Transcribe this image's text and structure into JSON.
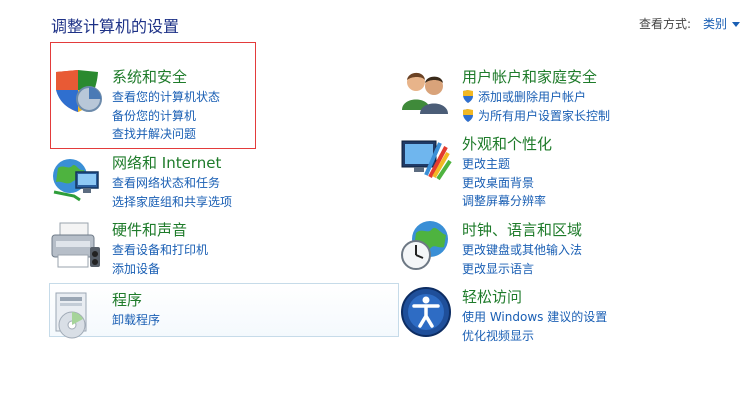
{
  "header": {
    "title": "调整计算机的设置",
    "view_label": "查看方式:",
    "view_value": "类别"
  },
  "left": [
    {
      "title": "系统和安全",
      "links": [
        "查看您的计算机状态",
        "备份您的计算机",
        "查找并解决问题"
      ]
    },
    {
      "title": "网络和 Internet",
      "links": [
        "查看网络状态和任务",
        "选择家庭组和共享选项"
      ]
    },
    {
      "title": "硬件和声音",
      "links": [
        "查看设备和打印机",
        "添加设备"
      ]
    },
    {
      "title": "程序",
      "links": [
        "卸载程序"
      ]
    }
  ],
  "right": [
    {
      "title": "用户帐户和家庭安全",
      "links": [
        "添加或删除用户帐户",
        "为所有用户设置家长控制"
      ]
    },
    {
      "title": "外观和个性化",
      "links": [
        "更改主题",
        "更改桌面背景",
        "调整屏幕分辨率"
      ]
    },
    {
      "title": "时钟、语言和区域",
      "links": [
        "更改键盘或其他输入法",
        "更改显示语言"
      ]
    },
    {
      "title": "轻松访问",
      "links": [
        "使用 Windows 建议的设置",
        "优化视频显示"
      ]
    }
  ],
  "colors": {
    "title_green": "#1e7b2a",
    "link_blue": "#1a5fb4",
    "header_blue": "#1e3287",
    "highlight_red": "#e33b3b"
  },
  "icons": {
    "security": "shield-icon",
    "network": "globe-network-icon",
    "hardware": "printer-icon",
    "programs": "programs-icon",
    "users": "users-icon",
    "appearance": "display-palette-icon",
    "clock": "clock-globe-icon",
    "access": "ease-of-access-icon"
  }
}
